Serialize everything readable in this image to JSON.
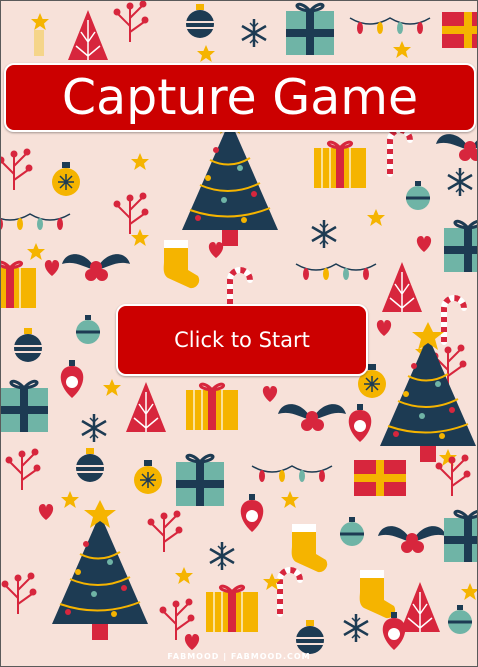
{
  "title": "Capture Game",
  "start_button_label": "Click to Start",
  "watermark": "FABMOOD | FABMOOD.COM",
  "colors": {
    "background": "#f7e1d9",
    "banner": "#cc0000",
    "banner_text": "#ffffff",
    "pattern_red": "#d7263d",
    "pattern_navy": "#1d3b53",
    "pattern_yellow": "#f5b400",
    "pattern_teal": "#6fb4a6"
  },
  "icons": [
    "christmas-tree-icon",
    "gift-box-icon",
    "ornament-icon",
    "candy-cane-icon",
    "snowflake-icon",
    "holly-icon",
    "stocking-icon",
    "star-icon",
    "heart-icon",
    "berry-branch-icon",
    "string-lights-icon",
    "candle-icon"
  ]
}
